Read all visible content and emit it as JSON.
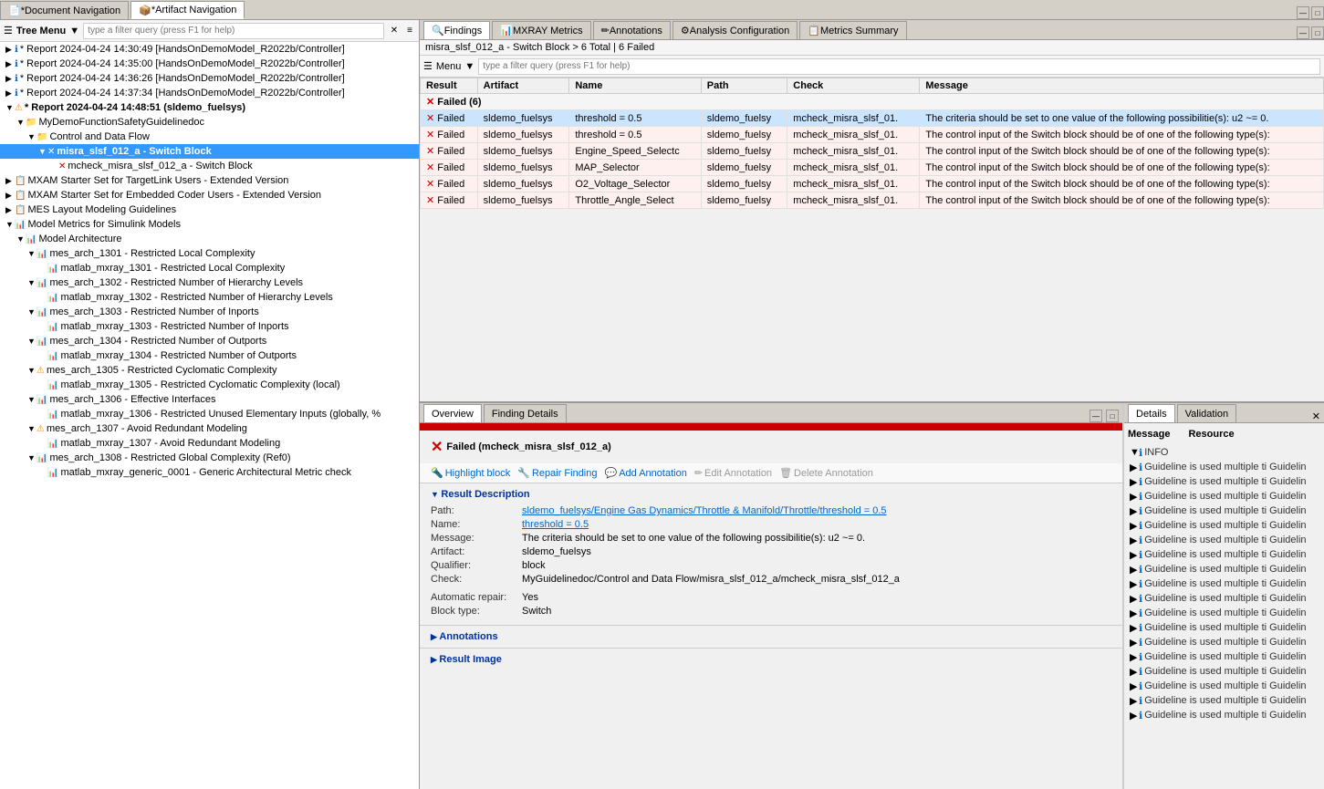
{
  "app": {
    "tabs": [
      {
        "id": "doc-nav",
        "label": "*Document Navigation",
        "active": false,
        "icon": "📄"
      },
      {
        "id": "artifact-nav",
        "label": "*Artifact Navigation",
        "active": true,
        "icon": "📦"
      }
    ]
  },
  "left_panel": {
    "toolbar": {
      "menu_label": "Tree Menu",
      "filter_placeholder": "type a filter query (press F1 for help)"
    },
    "tree": [
      {
        "id": 1,
        "level": 0,
        "icon": "📄",
        "label": "* Report 2024-04-24 14:30:49 [HandsOnDemoModel_R2022b/Controller]",
        "expanded": false,
        "status": "info"
      },
      {
        "id": 2,
        "level": 0,
        "icon": "📄",
        "label": "* Report 2024-04-24 14:35:00 [HandsOnDemoModel_R2022b/Controller]",
        "expanded": false,
        "status": "info"
      },
      {
        "id": 3,
        "level": 0,
        "icon": "📄",
        "label": "* Report 2024-04-24 14:36:26 [HandsOnDemoModel_R2022b/Controller]",
        "expanded": false,
        "status": "info"
      },
      {
        "id": 4,
        "level": 0,
        "icon": "📄",
        "label": "* Report 2024-04-24 14:37:34 [HandsOnDemoModel_R2022b/Controller]",
        "expanded": false,
        "status": "info"
      },
      {
        "id": 5,
        "level": 0,
        "icon": "📄",
        "label": "* Report 2024-04-24 14:48:51 (sldemo_fuelsys)",
        "expanded": true,
        "status": "warn",
        "bold": true
      },
      {
        "id": 6,
        "level": 1,
        "icon": "📁",
        "label": "MyDemoFunctionSafetyGuidelinedoc",
        "expanded": true,
        "status": ""
      },
      {
        "id": 7,
        "level": 2,
        "icon": "📁",
        "label": "Control and Data Flow",
        "expanded": true,
        "status": ""
      },
      {
        "id": 8,
        "level": 3,
        "icon": "⊞",
        "label": "misra_slsf_012_a - Switch Block",
        "expanded": true,
        "status": "error",
        "selected": true,
        "bold": true
      },
      {
        "id": 9,
        "level": 4,
        "icon": "⊞",
        "label": "mcheck_misra_slsf_012_a - Switch Block",
        "expanded": false,
        "status": "error"
      },
      {
        "id": 10,
        "level": 0,
        "icon": "📋",
        "label": "MXAM Starter Set for TargetLink Users - Extended Version",
        "expanded": false,
        "status": ""
      },
      {
        "id": 11,
        "level": 0,
        "icon": "📋",
        "label": "MXAM Starter Set for Embedded Coder Users - Extended Version",
        "expanded": false,
        "status": ""
      },
      {
        "id": 12,
        "level": 0,
        "icon": "📋",
        "label": "MES Layout Modeling Guidelines",
        "expanded": false,
        "status": ""
      },
      {
        "id": 13,
        "level": 0,
        "icon": "📊",
        "label": "Model Metrics for Simulink Models",
        "expanded": true,
        "status": ""
      },
      {
        "id": 14,
        "level": 1,
        "icon": "📊",
        "label": "Model Architecture",
        "expanded": true,
        "status": ""
      },
      {
        "id": 15,
        "level": 2,
        "icon": "📊",
        "label": "mes_arch_1301 - Restricted Local Complexity",
        "expanded": true,
        "status": ""
      },
      {
        "id": 16,
        "level": 3,
        "icon": "📊",
        "label": "matlab_mxray_1301 - Restricted Local Complexity",
        "expanded": false,
        "status": ""
      },
      {
        "id": 17,
        "level": 2,
        "icon": "📊",
        "label": "mes_arch_1302 - Restricted Number of Hierarchy Levels",
        "expanded": true,
        "status": ""
      },
      {
        "id": 18,
        "level": 3,
        "icon": "📊",
        "label": "matlab_mxray_1302 - Restricted Number of Hierarchy Levels",
        "expanded": false,
        "status": ""
      },
      {
        "id": 19,
        "level": 2,
        "icon": "📊",
        "label": "mes_arch_1303 - Restricted Number of Inports",
        "expanded": true,
        "status": ""
      },
      {
        "id": 20,
        "level": 3,
        "icon": "📊",
        "label": "matlab_mxray_1303 - Restricted Number of Inports",
        "expanded": false,
        "status": ""
      },
      {
        "id": 21,
        "level": 2,
        "icon": "📊",
        "label": "mes_arch_1304 - Restricted Number of Outports",
        "expanded": true,
        "status": ""
      },
      {
        "id": 22,
        "level": 3,
        "icon": "📊",
        "label": "matlab_mxray_1304 - Restricted Number of Outports",
        "expanded": false,
        "status": ""
      },
      {
        "id": 23,
        "level": 2,
        "icon": "⚠",
        "label": "mes_arch_1305 - Restricted Cyclomatic Complexity",
        "expanded": true,
        "status": "warn"
      },
      {
        "id": 24,
        "level": 3,
        "icon": "📊",
        "label": "matlab_mxray_1305 - Restricted Cyclomatic Complexity (local)",
        "expanded": false,
        "status": ""
      },
      {
        "id": 25,
        "level": 2,
        "icon": "📊",
        "label": "mes_arch_1306 - Effective Interfaces",
        "expanded": true,
        "status": ""
      },
      {
        "id": 26,
        "level": 3,
        "icon": "📊",
        "label": "matlab_mxray_1306 - Restricted Unused Elementary Inputs (globally, %",
        "expanded": false,
        "status": ""
      },
      {
        "id": 27,
        "level": 2,
        "icon": "⚠",
        "label": "mes_arch_1307 - Avoid Redundant Modeling",
        "expanded": true,
        "status": "warn"
      },
      {
        "id": 28,
        "level": 3,
        "icon": "📊",
        "label": "matlab_mxray_1307 - Avoid Redundant Modeling",
        "expanded": false,
        "status": ""
      },
      {
        "id": 29,
        "level": 2,
        "icon": "📊",
        "label": "mes_arch_1308 - Restricted Global Complexity (Ref0)",
        "expanded": true,
        "status": ""
      },
      {
        "id": 30,
        "level": 3,
        "icon": "📊",
        "label": "matlab_mxray_generic_0001 - Generic Architectural Metric check",
        "expanded": false,
        "status": ""
      }
    ]
  },
  "findings_panel": {
    "tabs": [
      {
        "id": "findings",
        "label": "Findings",
        "active": true,
        "icon": "🔍"
      },
      {
        "id": "mxray",
        "label": "MXRAY Metrics",
        "active": false,
        "icon": "📊"
      },
      {
        "id": "annotations",
        "label": "Annotations",
        "active": false,
        "icon": "✏"
      },
      {
        "id": "analysis-config",
        "label": "Analysis Configuration",
        "active": false,
        "icon": "⚙"
      },
      {
        "id": "metrics-summary",
        "label": "Metrics Summary",
        "active": false,
        "icon": "📋"
      }
    ],
    "breadcrumb": "misra_slsf_012_a - Switch Block > 6 Total | 6 Failed",
    "toolbar": {
      "menu_label": "Menu",
      "filter_placeholder": "type a filter query (press F1 for help)"
    },
    "table": {
      "columns": [
        "Result",
        "Artifact",
        "Name",
        "Path",
        "Check",
        "Message"
      ],
      "groups": [
        {
          "label": "Failed (6)",
          "status": "failed",
          "rows": [
            {
              "result": "Failed",
              "artifact": "sldemo_fuelsys",
              "name": "threshold = 0.5",
              "path": "sldemo_fuelsy",
              "check": "mcheck_misra_slsf_01.",
              "message": "The criteria should be set to one value of the following possibilitie(s): u2 ~= 0.",
              "selected": true
            },
            {
              "result": "Failed",
              "artifact": "sldemo_fuelsys",
              "name": "threshold = 0.5",
              "path": "sldemo_fuelsy",
              "check": "mcheck_misra_slsf_01.",
              "message": "The control input of the Switch block should be of one of the following type(s):"
            },
            {
              "result": "Failed",
              "artifact": "sldemo_fuelsys",
              "name": "Engine_Speed_Selectc",
              "path": "sldemo_fuelsy",
              "check": "mcheck_misra_slsf_01.",
              "message": "The control input of the Switch block should be of one of the following type(s):"
            },
            {
              "result": "Failed",
              "artifact": "sldemo_fuelsys",
              "name": "MAP_Selector",
              "path": "sldemo_fuelsy",
              "check": "mcheck_misra_slsf_01.",
              "message": "The control input of the Switch block should be of one of the following type(s):"
            },
            {
              "result": "Failed",
              "artifact": "sldemo_fuelsys",
              "name": "O2_Voltage_Selector",
              "path": "sldemo_fuelsy",
              "check": "mcheck_misra_slsf_01.",
              "message": "The control input of the Switch block should be of one of the following type(s):"
            },
            {
              "result": "Failed",
              "artifact": "sldemo_fuelsys",
              "name": "Throttle_Angle_Select",
              "path": "sldemo_fuelsy",
              "check": "mcheck_misra_slsf_01.",
              "message": "The control input of the Switch block should be of one of the following type(s):"
            }
          ]
        }
      ]
    }
  },
  "overview_panel": {
    "tabs": [
      {
        "id": "overview",
        "label": "Overview",
        "active": true
      },
      {
        "id": "finding-details",
        "label": "Finding Details",
        "active": false
      }
    ],
    "failed_title": "Failed (mcheck_misra_slsf_012_a)",
    "actions": [
      {
        "id": "highlight-block",
        "label": "Highlight block",
        "icon": "🔦",
        "disabled": false
      },
      {
        "id": "repair-finding",
        "label": "Repair Finding",
        "icon": "🔧",
        "disabled": false
      },
      {
        "id": "add-annotation",
        "label": "Add Annotation",
        "icon": "💬",
        "disabled": false
      },
      {
        "id": "edit-annotation",
        "label": "Edit Annotation",
        "icon": "✏",
        "disabled": true
      },
      {
        "id": "delete-annotation",
        "label": "Delete Annotation",
        "icon": "🗑",
        "disabled": true
      }
    ],
    "result_description": {
      "title": "Result Description",
      "fields": [
        {
          "label": "Path:",
          "value": "sldemo_fuelsys/Engine Gas Dynamics/Throttle & Manifold/Throttle/threshold = 0.5",
          "link": true
        },
        {
          "label": "Name:",
          "value": "threshold = 0.5",
          "link": true
        },
        {
          "label": "Message:",
          "value": "The criteria should be set to one value of the following possibilitie(s): u2 ~= 0.",
          "link": false
        },
        {
          "label": "Artifact:",
          "value": "sldemo_fuelsys",
          "link": false
        },
        {
          "label": "Qualifier:",
          "value": "block",
          "link": false
        },
        {
          "label": "Check:",
          "value": "MyGuidelinedoc/Control and Data Flow/misra_slsf_012_a/mcheck_misra_slsf_012_a",
          "link": false
        }
      ],
      "extra_fields": [
        {
          "label": "Automatic repair:",
          "value": "Yes"
        },
        {
          "label": "Block type:",
          "value": "Switch"
        }
      ]
    },
    "annotations": {
      "title": "Annotations"
    },
    "result_image": {
      "title": "Result Image"
    }
  },
  "right_sidebar": {
    "tabs": [
      {
        "id": "details",
        "label": "Details",
        "active": true
      },
      {
        "id": "validation",
        "label": "Validation",
        "active": false
      }
    ],
    "header": {
      "message_col": "Message",
      "resource_col": "Resource"
    },
    "items": [
      {
        "level": 0,
        "type": "group",
        "label": "INFO"
      },
      {
        "text": "Guideline is used multiple ti Guidelin"
      },
      {
        "text": "Guideline is used multiple ti Guidelin"
      },
      {
        "text": "Guideline is used multiple ti Guidelin"
      },
      {
        "text": "Guideline is used multiple ti Guidelin"
      },
      {
        "text": "Guideline is used multiple ti Guidelin"
      },
      {
        "text": "Guideline is used multiple ti Guidelin"
      },
      {
        "text": "Guideline is used multiple ti Guidelin"
      },
      {
        "text": "Guideline is used multiple ti Guidelin"
      },
      {
        "text": "Guideline is used multiple ti Guidelin"
      },
      {
        "text": "Guideline is used multiple ti Guidelin"
      },
      {
        "text": "Guideline is used multiple ti Guidelin"
      },
      {
        "text": "Guideline is used multiple ti Guidelin"
      },
      {
        "text": "Guideline is used multiple ti Guidelin"
      },
      {
        "text": "Guideline is used multiple ti Guidelin"
      },
      {
        "text": "Guideline is used multiple ti Guidelin"
      },
      {
        "text": "Guideline is used multiple ti Guidelin"
      },
      {
        "text": "Guideline is used multiple ti Guidelin"
      },
      {
        "text": "Guideline is used multiple ti Guidelin"
      }
    ]
  }
}
